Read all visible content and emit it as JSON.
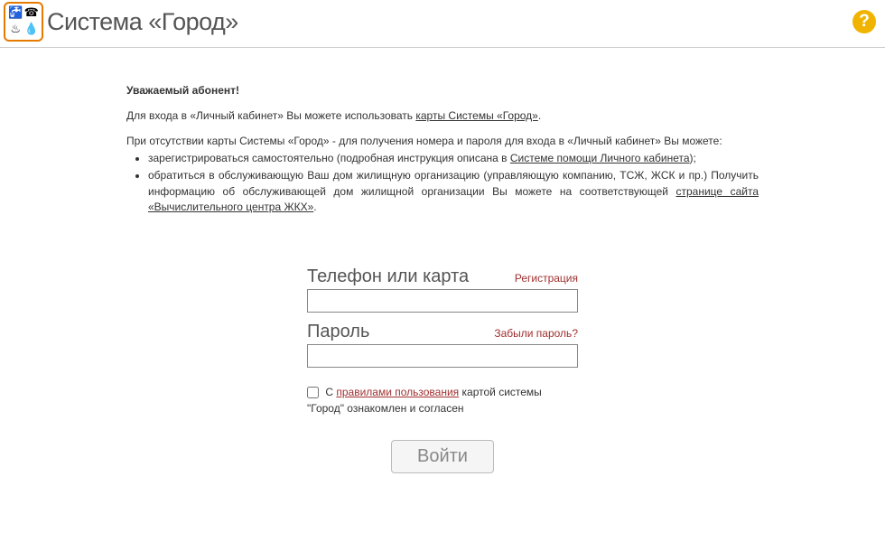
{
  "header": {
    "brand_title": "Система «Город»",
    "logo_glyphs": [
      "🚰",
      "☎",
      "♨",
      "💧"
    ]
  },
  "info": {
    "greeting": "Уважаемый абонент!",
    "intro_prefix": "Для входа в «Личный кабинет» Вы можете использовать ",
    "intro_link": "карты Системы «Город»",
    "intro_suffix": ".",
    "para2": "При отсутствии карты Системы «Город» - для получения номера и пароля для входа в «Личный кабинет» Вы можете:",
    "bullet1_prefix": "зарегистрироваться самостоятельно (подробная инструкция описана в ",
    "bullet1_link": "Системе помощи Личного кабинета",
    "bullet1_suffix": ");",
    "bullet2_prefix": "обратиться в обслуживающую Ваш дом жилищную организацию (управляющую компанию, ТСЖ, ЖСК и пр.) Получить информацию об обслуживающей дом жилищной организации Вы можете на соответствующей ",
    "bullet2_link": "странице сайта «Вычислительного центра ЖКХ»",
    "bullet2_suffix": "."
  },
  "form": {
    "phone_label": "Телефон или карта",
    "register_link": "Регистрация",
    "password_label": "Пароль",
    "forgot_link": "Забыли пароль?",
    "agree_prefix": "С ",
    "agree_link": "правилами пользования",
    "agree_suffix": " картой системы \"Город\" ознакомлен и согласен",
    "submit_label": "Войти"
  }
}
